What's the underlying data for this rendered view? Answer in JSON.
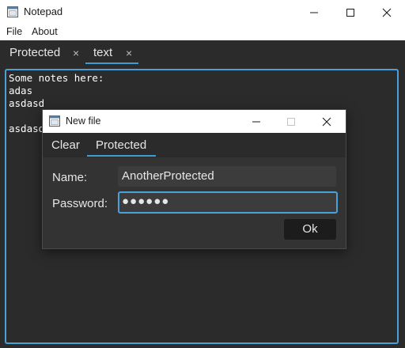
{
  "window": {
    "title": "Notepad",
    "icon": "notepad-app-icon",
    "controls": [
      "minimize-icon",
      "maximize-icon",
      "close-icon"
    ]
  },
  "menu": {
    "items": [
      {
        "label": "File"
      },
      {
        "label": "About"
      }
    ]
  },
  "tabs": [
    {
      "label": "Protected",
      "close": "×",
      "active": false
    },
    {
      "label": "text",
      "close": "×",
      "active": true
    }
  ],
  "editor": {
    "content": "Some notes here:\nadas\nasdasd\n\nasdasd"
  },
  "dialog": {
    "title": "New file",
    "icon": "notepad-app-icon",
    "tabs": [
      {
        "label": "Clear",
        "active": false
      },
      {
        "label": "Protected",
        "active": true
      }
    ],
    "name_label": "Name:",
    "name_value": "AnotherProtected",
    "password_label": "Password:",
    "password_value": "●●●●●●",
    "ok_label": "Ok"
  },
  "colors": {
    "accent": "#3d9bd6",
    "background": "#2b2b2b",
    "dialog_background": "#333333"
  }
}
